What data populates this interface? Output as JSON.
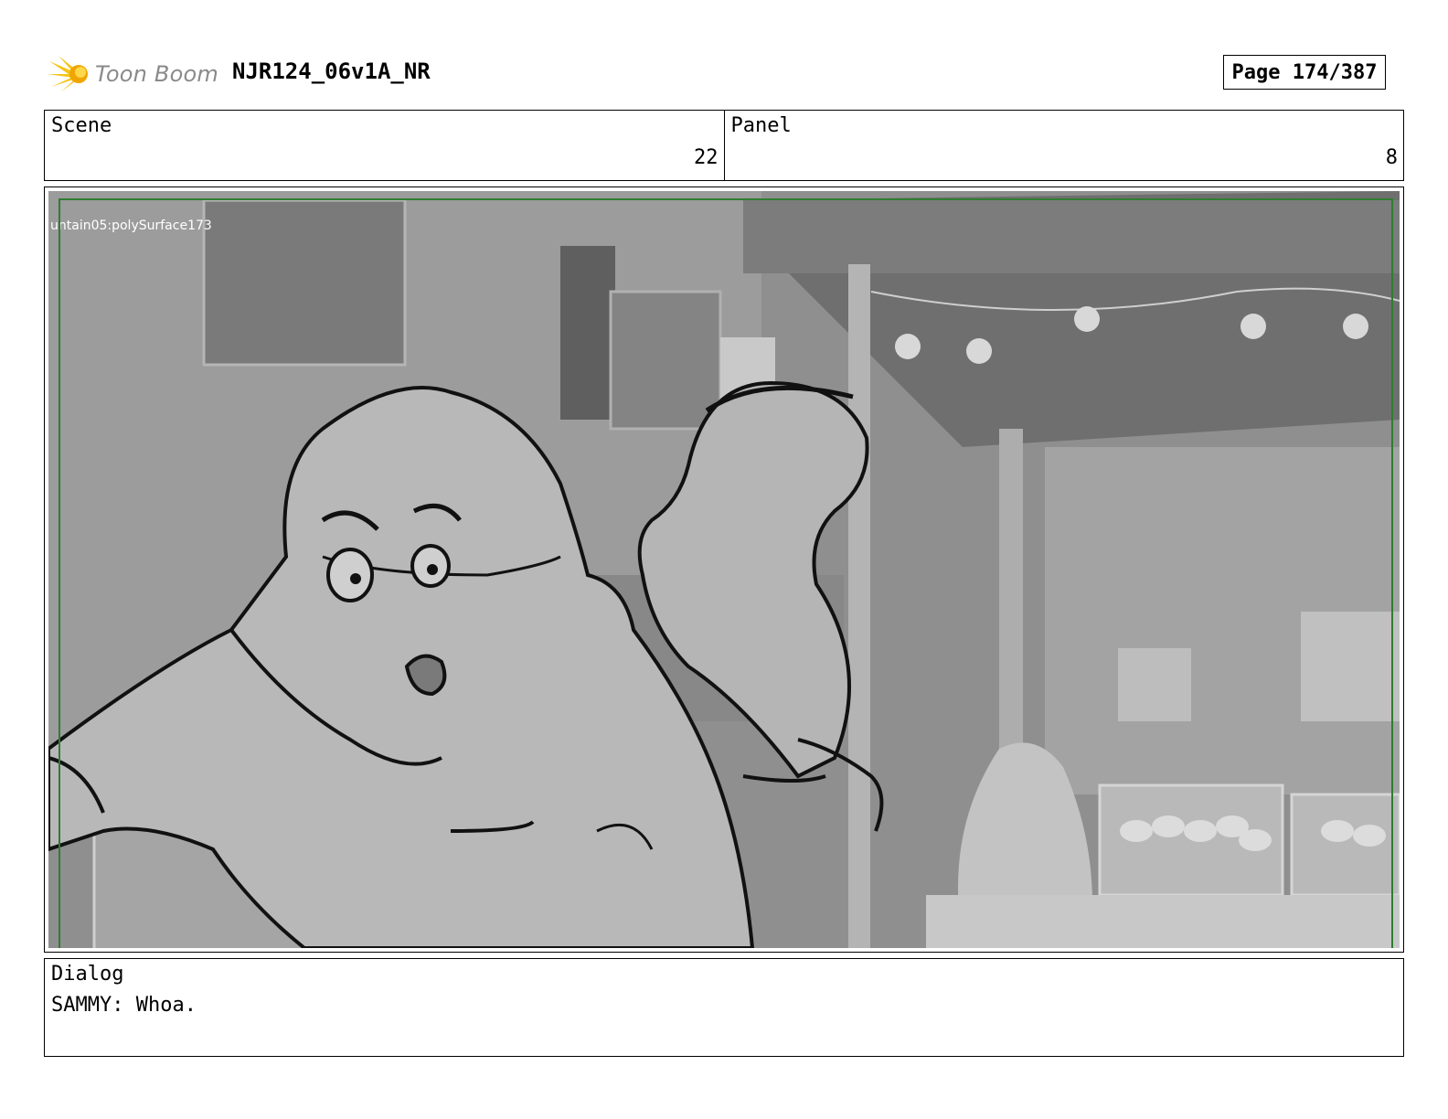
{
  "header": {
    "logo_text": "Toon Boom",
    "title": "NJR124_06v1A_NR",
    "page_label": "Page 174/387"
  },
  "scene": {
    "label": "Scene",
    "value": "22"
  },
  "panel": {
    "label": "Panel",
    "value": "8"
  },
  "artwork": {
    "overlay_label": "untain05:polySurface173",
    "safe_frame_color": "#2e7d32",
    "description_icons": [
      "starburst-logo-icon"
    ]
  },
  "dialog": {
    "label": "Dialog",
    "text": "SAMMY: Whoa."
  }
}
